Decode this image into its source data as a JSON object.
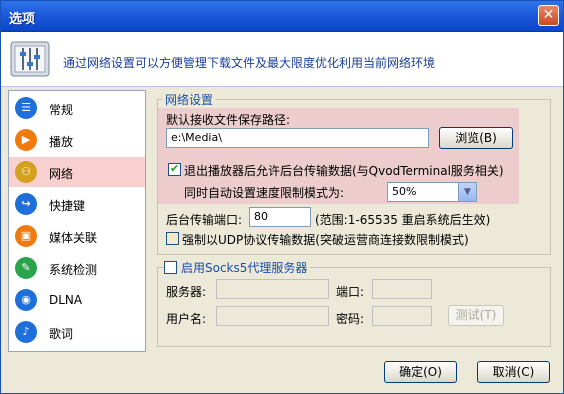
{
  "window": {
    "title": "选项",
    "close_glyph": "✕"
  },
  "header": {
    "text": "通过网络设置可以方便管理下载文件及最大限度优化利用当前网络环境"
  },
  "sidebar": {
    "items": [
      {
        "label": "常规",
        "icon": "general-icon",
        "color": "#1e6fd9",
        "glyph": "☰"
      },
      {
        "label": "播放",
        "icon": "play-icon",
        "color": "#f07a10",
        "glyph": "▶"
      },
      {
        "label": "网络",
        "icon": "network-icon",
        "color": "#d4a020",
        "glyph": "⚇"
      },
      {
        "label": "快捷键",
        "icon": "shortcut-icon",
        "color": "#1e6fd9",
        "glyph": "↪"
      },
      {
        "label": "媒体关联",
        "icon": "media-association-icon",
        "color": "#f07a10",
        "glyph": "▣"
      },
      {
        "label": "系统检测",
        "icon": "system-check-icon",
        "color": "#2aa34a",
        "glyph": "✎"
      },
      {
        "label": "DLNA",
        "icon": "dlna-icon",
        "color": "#1e6fd9",
        "glyph": "◉"
      },
      {
        "label": "歌词",
        "icon": "lyrics-icon",
        "color": "#1e6fd9",
        "glyph": "♪"
      }
    ],
    "active_index": 2
  },
  "network": {
    "group_title": "网络设置",
    "save_path_label": "默认接收文件保存路径:",
    "save_path_value": "e:\\Media\\",
    "browse_label": "浏览(B)",
    "background_transfer_label": "退出播放器后允许后台传输数据(与QvodTerminal服务相关)",
    "background_transfer_checked": true,
    "speed_limit_label": "同时自动设置速度限制模式为:",
    "speed_limit_value": "50%",
    "port_label": "后台传输端口:",
    "port_value": "80",
    "port_hint": "(范围:1-65535 重启系统后生效)",
    "force_udp_label": "强制以UDP协议传输数据(突破运营商连接数限制模式)",
    "force_udp_checked": false
  },
  "proxy": {
    "enable_label": "启用Socks5代理服务器",
    "enabled": false,
    "server_label": "服务器:",
    "server_value": "",
    "port_label": "端口:",
    "port_value": "",
    "username_label": "用户名:",
    "username_value": "",
    "password_label": "密码:",
    "password_value": "",
    "test_label": "测试(T)"
  },
  "footer": {
    "ok_label": "确定(O)",
    "cancel_label": "取消(C)"
  },
  "colors": {
    "accent": "#1c5adc",
    "highlight": "#eccccc",
    "active_item": "#f8d0d0"
  }
}
